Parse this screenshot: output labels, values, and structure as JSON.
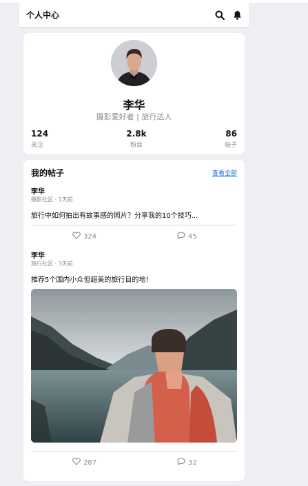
{
  "header": {
    "title": "个人中心",
    "icons": [
      "search-icon",
      "bell-icon"
    ]
  },
  "profile": {
    "name": "李华",
    "bio": "摄影爱好者 | 旅行达人",
    "stats": [
      {
        "value": "124",
        "label": "关注"
      },
      {
        "value": "2.8k",
        "label": "粉丝"
      },
      {
        "value": "86",
        "label": "帖子"
      }
    ]
  },
  "posts": {
    "title": "我的帖子",
    "view_all": "查看全部",
    "items": [
      {
        "author": "李华",
        "meta": "摄影社区 · 1天前",
        "text": "旅行中如何拍出有故事感的照片？分享我的10个技巧...",
        "likes": "324",
        "comments": "45"
      },
      {
        "author": "李华",
        "meta": "旅行社区 · 3天前",
        "text": "推荐5个国内小众但超美的旅行目的地！",
        "likes": "287",
        "comments": "32"
      }
    ]
  },
  "colors": {
    "background": "#eeeef3",
    "card": "#ffffff",
    "link": "#1a6fe0",
    "muted": "#8a8a8f"
  }
}
